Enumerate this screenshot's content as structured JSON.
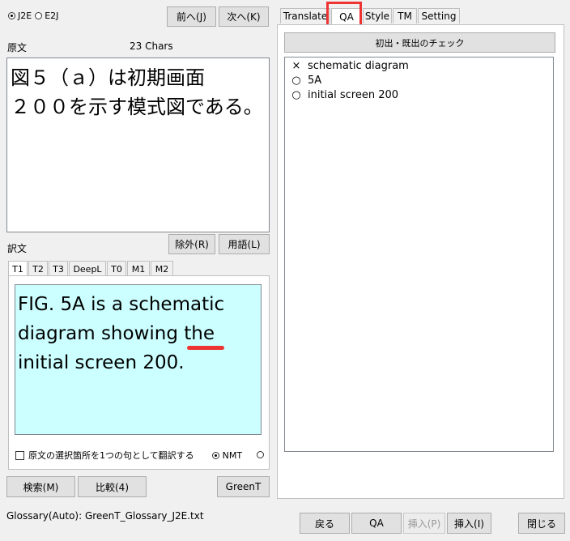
{
  "mode": {
    "options": [
      "J2E",
      "E2J"
    ],
    "selected": "J2E"
  },
  "nav": {
    "prev": "前へ(J)",
    "next": "次へ(K)"
  },
  "source": {
    "label": "原文",
    "char_count": "23 Chars",
    "lines": [
      "図５（ａ）は初期画面",
      "２００を示す模式図である。"
    ]
  },
  "target": {
    "label": "訳文",
    "exclude_button": "除外(R)",
    "terms_button": "用語(L)",
    "tabs": [
      "T1",
      "T2",
      "T3",
      "DeepL",
      "T0",
      "M1",
      "M2"
    ],
    "active_tab": "T1",
    "text_lines": [
      "FIG. 5A is a schematic",
      "diagram showing ",
      "initial screen 200."
    ],
    "flagged_word": "the"
  },
  "options": {
    "sentence_checkbox_label": "原文の選択箇所を1つの句として翻訳する",
    "nmt_label": "NMT"
  },
  "bottom_left": {
    "search": "検索(M)",
    "compare": "比較(4)",
    "greent": "GreenT"
  },
  "right_tabs": [
    "Translate",
    "QA",
    "Style",
    "TM",
    "Setting"
  ],
  "active_right_tab": "QA",
  "qa": {
    "check_button": "初出・既出のチェック",
    "items": [
      {
        "mark": "×",
        "text": "schematic diagram"
      },
      {
        "mark": "○",
        "text": "5A"
      },
      {
        "mark": "○",
        "text": "initial screen 200"
      }
    ]
  },
  "status": {
    "glossary": "Glossary(Auto): GreenT_Glossary_J2E.txt"
  },
  "footer": {
    "back": "戻る",
    "qa": "QA",
    "insert_p": "挿入(P)",
    "insert_i": "挿入(I)",
    "close": "閉じる"
  },
  "colors": {
    "highlight": "#ee3333",
    "target_bg": "#ccffff"
  }
}
